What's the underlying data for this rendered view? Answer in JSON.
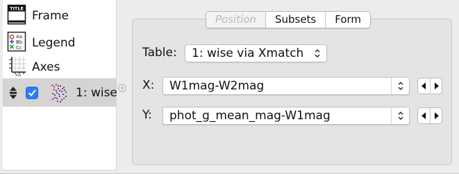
{
  "layers": {
    "frame_label": "Frame",
    "legend_label": "Legend",
    "axes_label": "Axes",
    "wise_label": "1: wise",
    "frame_icon_text": "TITLE",
    "wise_checked": true
  },
  "tabs": [
    {
      "label": "Position",
      "enabled": false
    },
    {
      "label": "Subsets",
      "enabled": true
    },
    {
      "label": "Form",
      "enabled": true
    }
  ],
  "form": {
    "table_label": "Table:",
    "table_value": "1: wise via Xmatch",
    "x_label": "X:",
    "x_value": "W1mag-W2mag",
    "y_label": "Y:",
    "y_value": "phot_g_mean_mag-W1mag"
  },
  "colors": {
    "selection": "#d4d4d4",
    "checkbox": "#2f7df6",
    "scatter_red": "#d0312d",
    "scatter_blue": "#2b4fd8"
  }
}
